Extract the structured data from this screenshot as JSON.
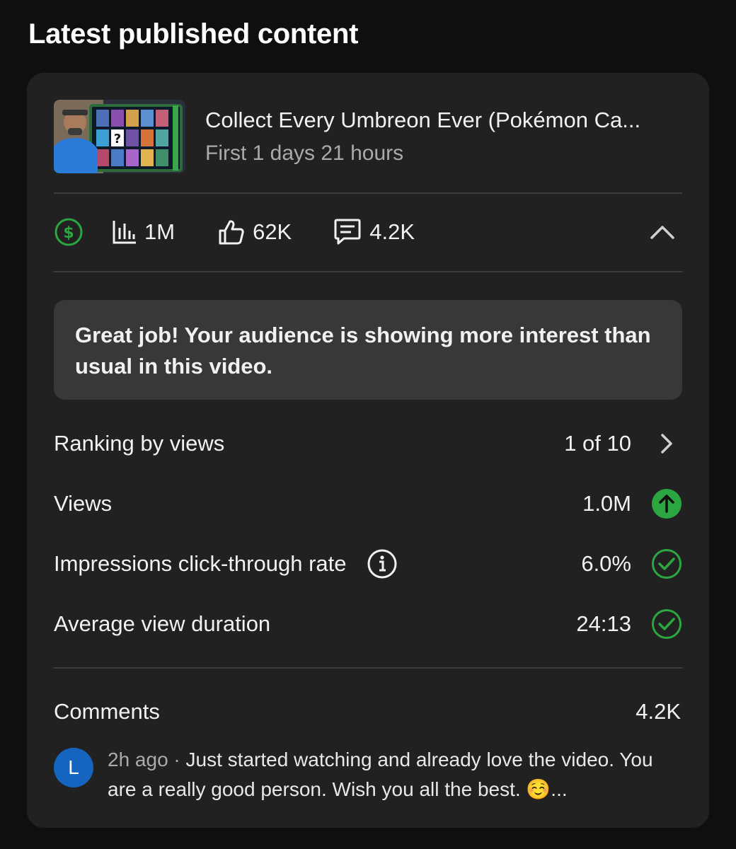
{
  "section": {
    "title": "Latest published content"
  },
  "video": {
    "title": "Collect Every Umbreon Ever (Pokémon Ca...",
    "subtitle": "First 1 days 21 hours",
    "thumbnail_icon": "video-thumbnail"
  },
  "stats": {
    "monetization_icon": "dollar-icon",
    "views_icon": "bar-chart-icon",
    "views": "1M",
    "likes_icon": "thumbs-up-icon",
    "likes": "62K",
    "comments_icon": "comment-icon",
    "comments": "4.2K",
    "collapse_icon": "chevron-up-icon"
  },
  "insight": {
    "message": "Great job! Your audience is showing more interest than usual in this video."
  },
  "metrics": [
    {
      "label": "Ranking by views",
      "value": "1 of 10",
      "status_icon": "chevron-right-icon"
    },
    {
      "label": "Views",
      "value": "1.0M",
      "status_icon": "arrow-up-circle-icon"
    },
    {
      "label": "Impressions click-through rate",
      "value": "6.0%",
      "status_icon": "check-circle-icon",
      "info_icon": "info-icon"
    },
    {
      "label": "Average view duration",
      "value": "24:13",
      "status_icon": "check-circle-icon"
    }
  ],
  "comments_section": {
    "label": "Comments",
    "count": "4.2K",
    "latest": {
      "avatar_initial": "L",
      "time": "2h ago",
      "separator": "·",
      "text": "Just started watching and already love the video. You are a really good person. Wish you all the best. ☺️..."
    }
  },
  "colors": {
    "background": "#0f0f0f",
    "card": "#212121",
    "insight_box": "#383838",
    "positive_green": "#2ba640",
    "avatar_blue": "#1565c0",
    "secondary_text": "#aaaaaa"
  }
}
